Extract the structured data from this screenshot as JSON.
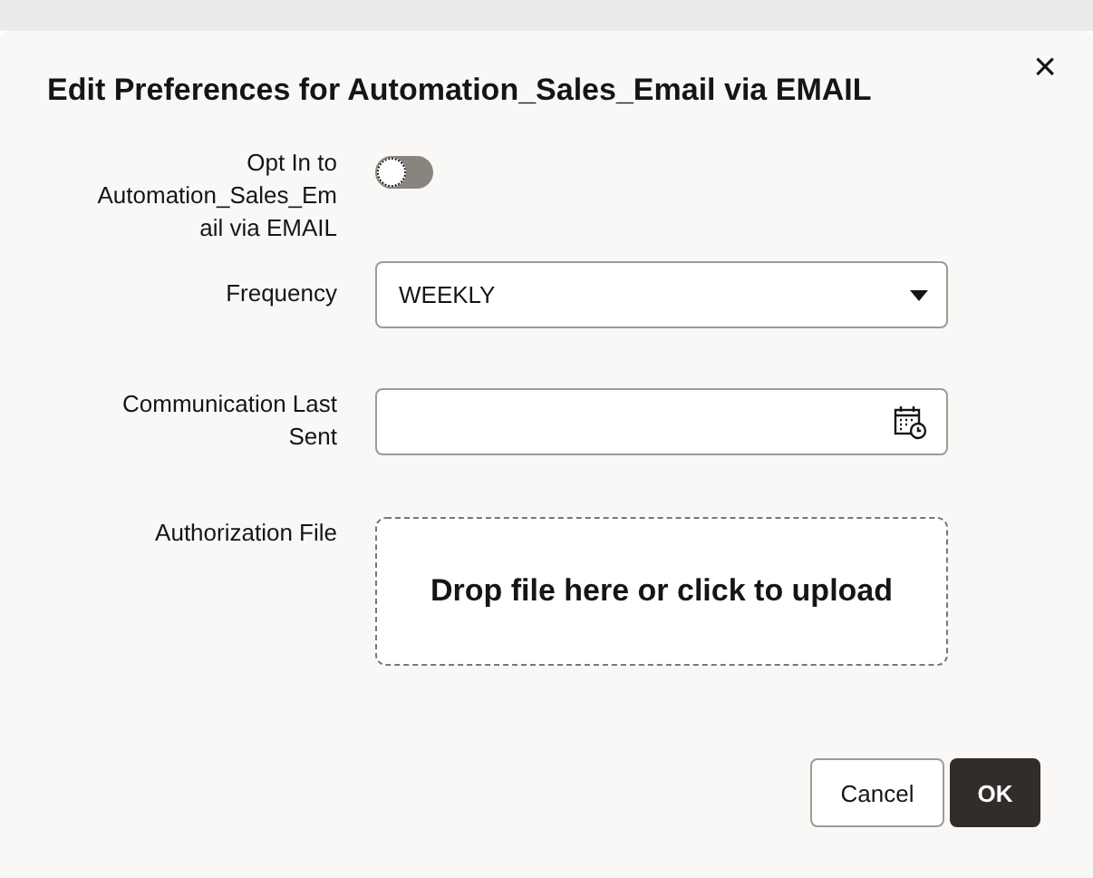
{
  "dialog": {
    "title": "Edit Preferences for Automation_Sales_Email via EMAIL",
    "close": "×"
  },
  "fields": [
    {
      "kind": "toggle",
      "label": "Opt In to Automation_Sales_Email via EMAIL",
      "on": false
    },
    {
      "kind": "select",
      "label": "Frequency",
      "value": "WEEKLY"
    },
    {
      "kind": "date",
      "label": "Communication Last Sent"
    },
    {
      "kind": "upload",
      "label": "Authorization File",
      "prompt": "Drop file here or click to upload"
    }
  ],
  "buttons": [
    {
      "label": "Cancel",
      "kind": "secondary"
    },
    {
      "label": "OK",
      "kind": "primary"
    }
  ]
}
